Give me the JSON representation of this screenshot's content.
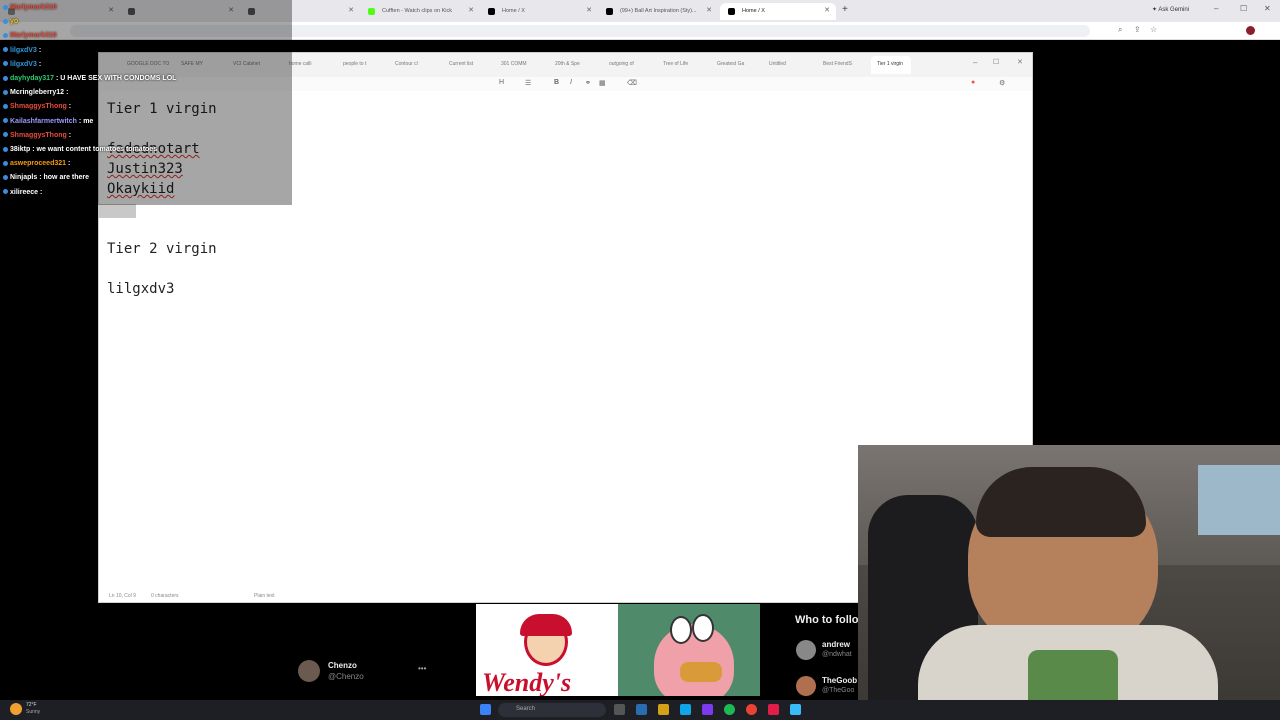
{
  "browser": {
    "tabs": [
      {
        "label": "",
        "color": "#888"
      },
      {
        "label": "",
        "color": "#555"
      },
      {
        "label": "",
        "color": "#555"
      },
      {
        "label": "Cufften - Watch clips on Kick",
        "color": "#53fc18"
      },
      {
        "label": "Home / X",
        "color": "#000"
      },
      {
        "label": "(99+) Ball Art Inspiration (Sty)...",
        "color": "#000"
      },
      {
        "label": "Home / X",
        "color": "#000"
      }
    ],
    "ask_label": "Ask Gemini"
  },
  "chat": [
    {
      "user": "Marlymark310",
      "text": "",
      "color": "#e74c3c"
    },
    {
      "user": "yo",
      "text": "",
      "color": "#f1c40f"
    },
    {
      "user": "Marlymark310",
      "text": "",
      "color": "#e74c3c"
    },
    {
      "user": "lilgxdV3",
      "text": ":",
      "color": "#3498db"
    },
    {
      "user": "lilgxdV3",
      "text": ":",
      "color": "#3498db"
    },
    {
      "user": "dayhyday317",
      "text": ": U HAVE SEX WITH CONDOMS LOL",
      "color": "#2ecc71"
    },
    {
      "user": "Mcringleberry12",
      "text": ":",
      "color": "#fff"
    },
    {
      "user": "ShmaggysThong",
      "text": ":",
      "color": "#e74c3c"
    },
    {
      "user": "Kailashfarmertwitch",
      "text": ": me",
      "color": "#9b9bff"
    },
    {
      "user": "ShmaggysThong",
      "text": ":",
      "color": "#e74c3c"
    },
    {
      "user": "38iktp",
      "text": ": we want content tomatoes tomatoes",
      "color": "#fff"
    },
    {
      "user": "asweproceed321",
      "text": ":",
      "color": "#f39c12"
    },
    {
      "user": "Ninjapls",
      "text": ": how are there ",
      "color": "#fff"
    },
    {
      "user": "xilireece",
      "text": ":",
      "color": "#fff"
    }
  ],
  "editor": {
    "tabs": [
      "GOOGLE DOC TO",
      "SAFE MY",
      "VCI Cabinet",
      "home calli",
      "people to t",
      "Contour cl",
      "Current list",
      "301 COMM",
      "20th & Spe",
      "outgoing of",
      "Tree of Life",
      "Greatest Ga",
      "Untitled",
      "Best FriendS",
      "Tier 1 virgin"
    ],
    "lines": [
      "Tier 1 virgin",
      "",
      "fadednotart",
      "Justin323",
      "Okaykiid",
      "",
      "",
      "Tier 2 virgin",
      "",
      "lilgxdv3"
    ],
    "status_left": "Ln 10, Col 9",
    "status_chars": "0 characters",
    "status_mode": "Plain text"
  },
  "background": {
    "user_name": "Chenzo",
    "user_handle": "@Chenzo",
    "who_to_follow": "Who to follo",
    "suggest1_name": "andrew",
    "suggest1_handle": "@ndwhat",
    "suggest2_name": "TheGoob",
    "suggest2_handle": "@TheGoo",
    "wendys_label": "Wendy's"
  },
  "taskbar": {
    "weather": "72°F",
    "weather_desc": "Sunny",
    "search_placeholder": "Search"
  }
}
